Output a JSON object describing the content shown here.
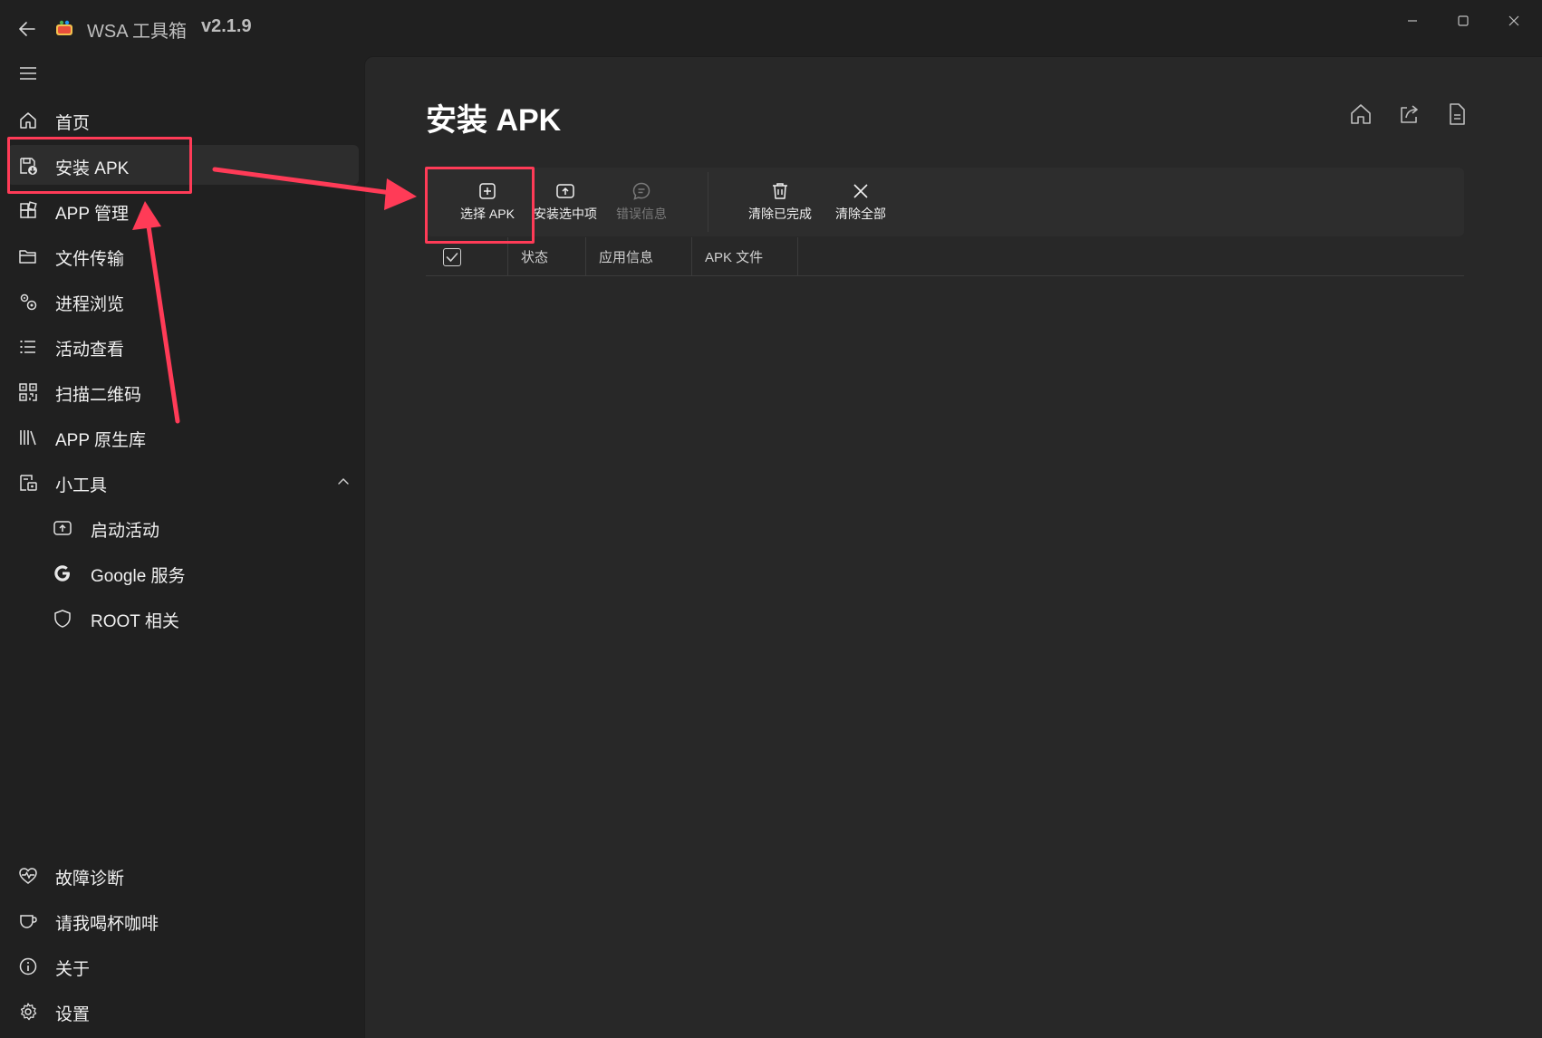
{
  "window": {
    "title": "WSA 工具箱",
    "version": "v2.1.9"
  },
  "nav": {
    "items": [
      {
        "label": "首页",
        "icon": "home-icon"
      },
      {
        "label": "安装 APK",
        "icon": "install-apk-icon",
        "selected": true
      },
      {
        "label": "APP 管理",
        "icon": "apps-icon"
      },
      {
        "label": "文件传输",
        "icon": "folder-icon"
      },
      {
        "label": "进程浏览",
        "icon": "process-icon"
      },
      {
        "label": "活动查看",
        "icon": "list-icon"
      },
      {
        "label": "扫描二维码",
        "icon": "qrcode-icon"
      },
      {
        "label": "APP 原生库",
        "icon": "library-icon"
      },
      {
        "label": "小工具",
        "icon": "tools-icon",
        "expanded": true
      }
    ],
    "sub_items": [
      {
        "label": "启动活动",
        "icon": "launch-activity-icon"
      },
      {
        "label": "Google 服务",
        "icon": "google-icon"
      },
      {
        "label": "ROOT 相关",
        "icon": "shield-icon"
      }
    ],
    "footer_items": [
      {
        "label": "故障诊断",
        "icon": "heart-pulse-icon"
      },
      {
        "label": "请我喝杯咖啡",
        "icon": "coffee-icon"
      },
      {
        "label": "关于",
        "icon": "info-icon"
      },
      {
        "label": "设置",
        "icon": "settings-icon"
      }
    ]
  },
  "page": {
    "title": "安装 APK"
  },
  "command_bar": {
    "select_apk": "选择 APK",
    "install_selected": "安装选中项",
    "error_info": "错误信息",
    "clear_completed": "清除已完成",
    "clear_all": "清除全部"
  },
  "table": {
    "columns": [
      "状态",
      "应用信息",
      "APK 文件"
    ],
    "select_all_checked": true
  },
  "colors": {
    "background": "#202020",
    "content": "#282828",
    "highlight": "#ff3b57"
  }
}
